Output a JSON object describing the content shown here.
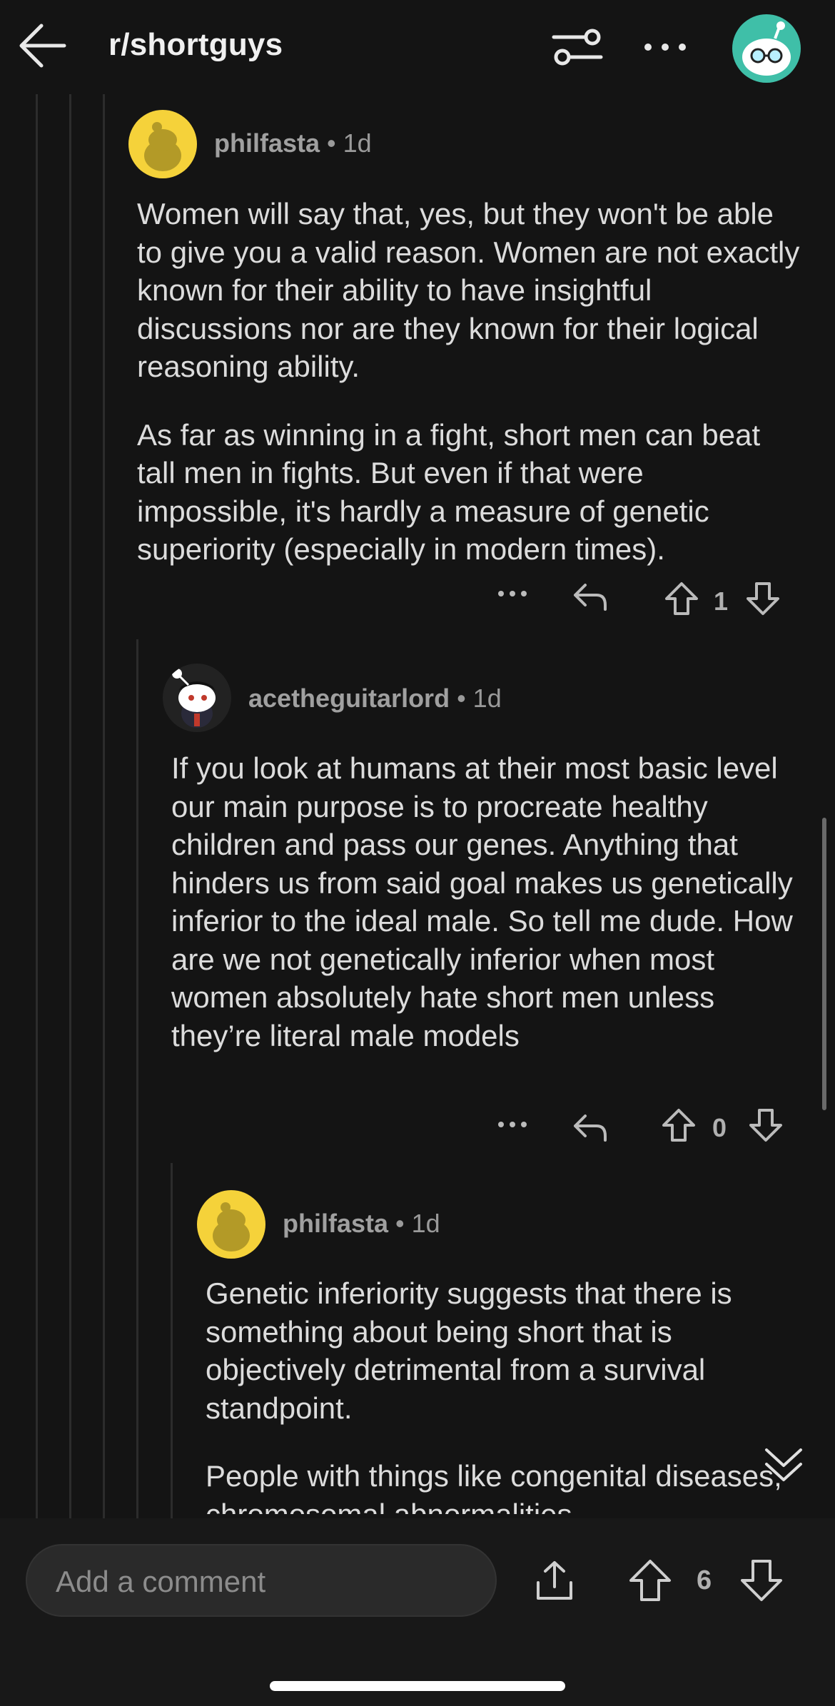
{
  "header": {
    "subreddit": "r/shortguys",
    "icons": [
      "back-arrow-icon",
      "filter-sliders-icon",
      "more-options-icon",
      "user-avatar-icon"
    ]
  },
  "comments": [
    {
      "username": "philfasta",
      "age": "1d",
      "paragraphs": [
        "Women will say that, yes, but they won't be able to give you a valid reason. Women are not exactly known for their ability to have insightful discussions nor are they known for their logical reasoning ability.",
        "As far as winning in a fight, short men can beat tall men in fights. But even if that were impossible, it's hardly a measure of genetic superiority (especially in modern times)."
      ],
      "votes": "1"
    },
    {
      "username": "acetheguitarlord",
      "age": "1d",
      "paragraphs": [
        "If you look at humans at their most basic level our main purpose is to procreate healthy children and pass our genes. Anything that hinders us from said goal makes us genetically inferior to the ideal male. So tell me dude. How are we not genetically inferior when most women absolutely hate short men unless they’re literal male models"
      ],
      "votes": "0"
    },
    {
      "username": "philfasta",
      "age": "1d",
      "paragraphs": [
        "Genetic inferiority suggests that there is something about being short that is objectively detrimental from a survival standpoint.",
        "People with things like congenital diseases, chromosomal abnormalities"
      ]
    }
  ],
  "bottom_bar": {
    "comment_placeholder": "Add a comment",
    "post_votes": "6"
  },
  "separator": "•",
  "colors": {
    "background": "#141414",
    "text": "#dcdcdc",
    "meta": "#9a9a9a",
    "avatar_yellow": "#f5d23a",
    "avatar_teal": "#3fbfa8"
  }
}
